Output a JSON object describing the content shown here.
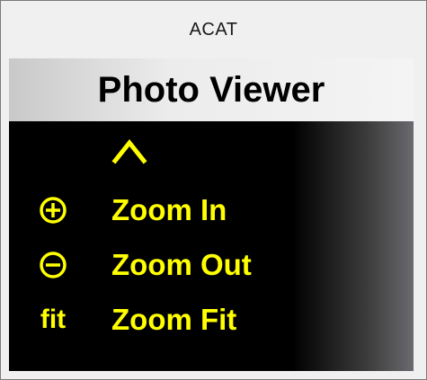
{
  "window": {
    "title": "ACAT"
  },
  "panel": {
    "title": "Photo Viewer"
  },
  "menu": {
    "items": [
      {
        "icon": "chevron-up-icon",
        "label": ""
      },
      {
        "icon": "zoom-in-icon",
        "label": "Zoom In"
      },
      {
        "icon": "zoom-out-icon",
        "label": "Zoom Out"
      },
      {
        "icon": "fit-icon",
        "label": "Zoom Fit",
        "icon_text": "fit"
      }
    ]
  },
  "colors": {
    "menu_text": "#ffff00",
    "menu_background": "#000000",
    "header_background": "#ececec",
    "header_text": "#000000"
  }
}
